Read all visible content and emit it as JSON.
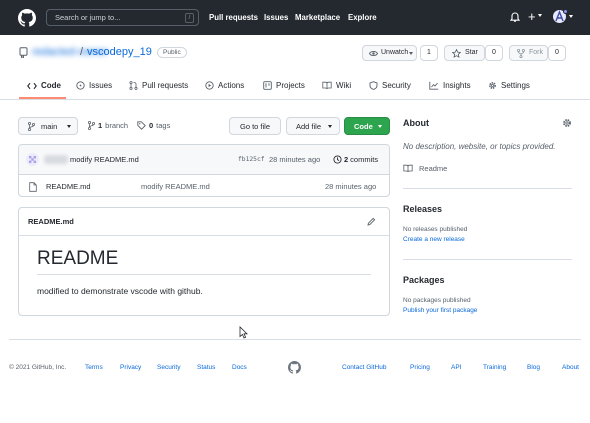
{
  "header": {
    "search_placeholder": "Search or jump to...",
    "slash_key": "/",
    "nav": [
      "Pull requests",
      "Issues",
      "Marketplace",
      "Explore"
    ]
  },
  "repo": {
    "owner": "redacted-owner",
    "separator": "/",
    "name": "vscodepy_19",
    "visibility": "Public",
    "unwatch_label": "Unwatch",
    "unwatch_count": "1",
    "star_label": "Star",
    "star_count": "0",
    "fork_label": "Fork",
    "fork_count": "0"
  },
  "tabs": [
    "Code",
    "Issues",
    "Pull requests",
    "Actions",
    "Projects",
    "Wiki",
    "Security",
    "Insights",
    "Settings"
  ],
  "toolbar": {
    "branch": "main",
    "branch_count": "1",
    "branch_word": "branch",
    "tag_count": "0",
    "tag_word": "tags",
    "go_to_file": "Go to file",
    "add_file": "Add file",
    "code": "Code"
  },
  "commit": {
    "message": "modify README.md",
    "sha": "fb125cf",
    "time": "28 minutes ago",
    "commit_count": "2",
    "commit_word": "commits"
  },
  "files": [
    {
      "name": "README.md",
      "message": "modify README.md",
      "time": "28 minutes ago"
    }
  ],
  "readme": {
    "filename": "README.md",
    "heading": "README",
    "body": "modified to demonstrate vscode with github."
  },
  "sidebar": {
    "about_title": "About",
    "about_desc": "No description, website, or topics provided.",
    "readme_link": "Readme",
    "releases_title": "Releases",
    "releases_none": "No releases published",
    "releases_link": "Create a new release",
    "packages_title": "Packages",
    "packages_none": "No packages published",
    "packages_link": "Publish your first package"
  },
  "footer": {
    "copyright": "© 2021 GitHub, Inc.",
    "left_links": [
      "Terms",
      "Privacy",
      "Security",
      "Status",
      "Docs"
    ],
    "right_links": [
      "Contact GitHub",
      "Pricing",
      "API",
      "Training",
      "Blog",
      "About"
    ]
  },
  "colors": {
    "header_bg": "#24292f",
    "link": "#0969da",
    "primary_button": "#2da44e",
    "selected_tab_underline": "#fd8c73"
  }
}
